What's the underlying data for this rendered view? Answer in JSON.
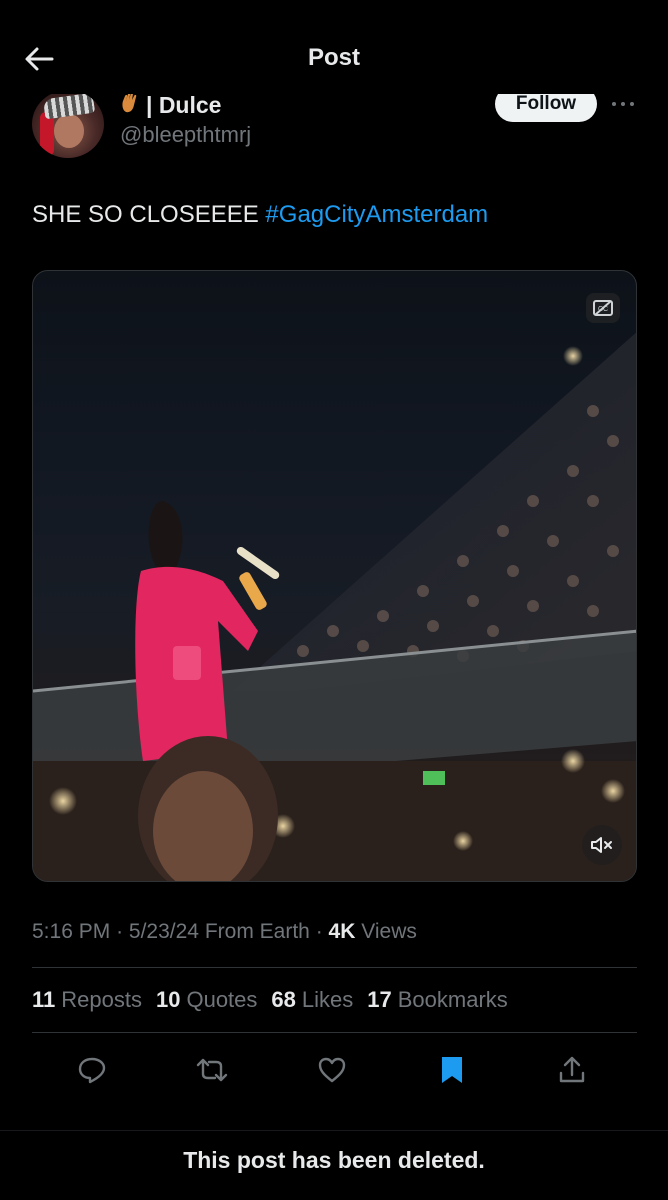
{
  "header": {
    "title": "Post"
  },
  "author": {
    "display_name": "| Dulce",
    "handle": "@bleepthtmrj",
    "follow_label": "Follow"
  },
  "post": {
    "text": "SHE SO CLOSEEEE ",
    "hashtag": "#GagCityAmsterdam"
  },
  "meta": {
    "time": "5:16 PM",
    "date": "5/23/24",
    "source": "From Earth",
    "views_count": "4K",
    "views_label": "Views"
  },
  "stats": {
    "reposts_count": "11",
    "reposts_label": "Reposts",
    "quotes_count": "10",
    "quotes_label": "Quotes",
    "likes_count": "68",
    "likes_label": "Likes",
    "bookmarks_count": "17",
    "bookmarks_label": "Bookmarks"
  },
  "icons": {
    "back": "arrow-left-icon",
    "more": "more-dots-icon",
    "captions": "captions-off-icon",
    "mute": "muted-speaker-icon",
    "reply": "reply-icon",
    "repost": "repost-icon",
    "like": "heart-icon",
    "bookmark": "bookmark-filled-icon",
    "share": "share-icon"
  },
  "colors": {
    "accent": "#1d9bf0",
    "text_primary": "#e7e9ea",
    "text_secondary": "#71767b",
    "background": "#000000"
  },
  "footer": {
    "deleted_text": "This post has been deleted."
  }
}
